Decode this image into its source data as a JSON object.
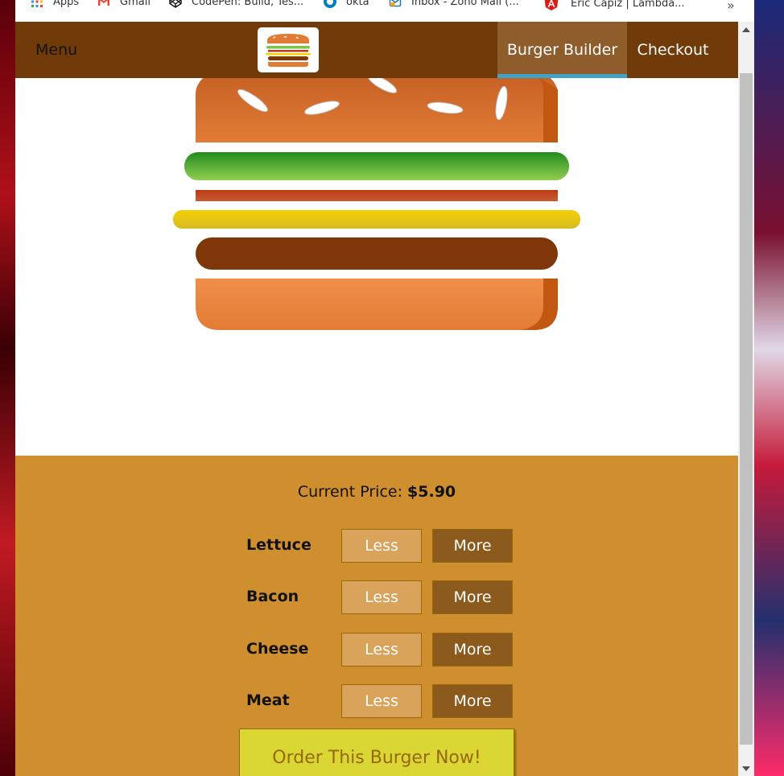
{
  "bookmarks": {
    "items": [
      {
        "label": "Apps",
        "icon": "apps-grid-icon"
      },
      {
        "label": "Gmail",
        "icon": "gmail-icon"
      },
      {
        "label": "CodePen: Build, Tes...",
        "icon": "codepen-icon"
      },
      {
        "label": "okta",
        "icon": "okta-icon"
      },
      {
        "label": "Inbox - Zoho Mail (...",
        "icon": "zoho-mail-icon"
      },
      {
        "label": "Eric Capiz | Lambda...",
        "icon": "angular-icon"
      }
    ],
    "more": "»"
  },
  "toolbar": {
    "menu_label": "Menu",
    "logo_icon": "burger-logo-icon",
    "nav": [
      {
        "label": "Burger Builder",
        "active": true
      },
      {
        "label": "Checkout",
        "active": false
      }
    ]
  },
  "burger": {
    "ingredients": [
      "lettuce",
      "bacon",
      "cheese",
      "meat"
    ]
  },
  "controls": {
    "price_label": "Current Price:",
    "price_value": "$5.90",
    "rows": [
      {
        "label": "Lettuce",
        "less": "Less",
        "more": "More"
      },
      {
        "label": "Bacon",
        "less": "Less",
        "more": "More"
      },
      {
        "label": "Cheese",
        "less": "Less",
        "more": "More"
      },
      {
        "label": "Meat",
        "less": "Less",
        "more": "More"
      }
    ],
    "order_label": "Order This Burger Now!"
  },
  "colors": {
    "toolbar": "#703b09",
    "nav_active": "#8f5c2c",
    "nav_active_border": "#40a4c8",
    "controls_bg": "#cf8f2e",
    "less_bg": "#d9a35c",
    "more_bg": "#8c5a1c",
    "order_bg": "#dad735",
    "order_text": "#966909",
    "lettuce": "#7cc540",
    "bacon": "#bf3813",
    "cheese": "#f4d004",
    "meat": "#7f3608",
    "bun": "#e27b36"
  }
}
